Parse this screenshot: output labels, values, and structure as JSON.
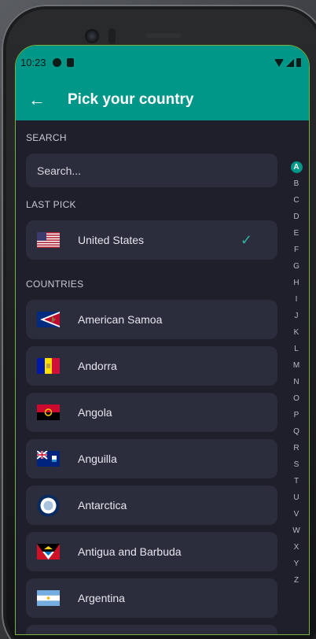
{
  "status": {
    "time": "10:23"
  },
  "appbar": {
    "title": "Pick your country"
  },
  "search": {
    "section_label": "SEARCH",
    "placeholder": "Search..."
  },
  "last_pick": {
    "section_label": "LAST PICK",
    "country": "United States",
    "selected": true
  },
  "countries": {
    "section_label": "COUNTRIES",
    "items": [
      {
        "name": "American Samoa",
        "flag": "flag-american-samoa"
      },
      {
        "name": "Andorra",
        "flag": "flag-andorra"
      },
      {
        "name": "Angola",
        "flag": "flag-angola"
      },
      {
        "name": "Anguilla",
        "flag": "flag-anguilla"
      },
      {
        "name": "Antarctica",
        "flag": "flag-antarctica"
      },
      {
        "name": "Antigua and Barbuda",
        "flag": "flag-antigua-and-barbuda"
      },
      {
        "name": "Argentina",
        "flag": "flag-argentina"
      }
    ]
  },
  "alphabet_index": {
    "active": "A",
    "letters": [
      "A",
      "B",
      "C",
      "D",
      "E",
      "F",
      "G",
      "H",
      "I",
      "J",
      "K",
      "L",
      "M",
      "N",
      "O",
      "P",
      "Q",
      "R",
      "S",
      "T",
      "U",
      "V",
      "W",
      "X",
      "Y",
      "Z"
    ]
  },
  "colors": {
    "accent": "#009688",
    "background": "#1e1f2b",
    "card": "#2b2c3c",
    "check": "#2fb39e"
  }
}
